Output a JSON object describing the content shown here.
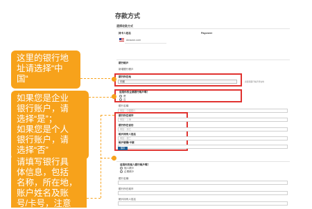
{
  "page_title": "存款方式",
  "section_deposit": "選擇收款方式",
  "account_info": {
    "owner_label": "持卡人姓名",
    "owner_value": "Amazon.com",
    "third_label": "Payoneer",
    "third_value": "Amazon.com"
  },
  "bank_section": {
    "header": "銀行帳戶",
    "subheader": "新增銀行帳戶",
    "country_label": "銀行所在地",
    "country_value": "中國",
    "country_hint": "請選擇銀行帳戶所在地",
    "business_question": "這是你的企業銀行帳戶嗎？",
    "radio_yes": "是",
    "radio_no": "否",
    "bank_name_label": "銀行名稱",
    "bank_name_placeholder": "例如：中國銀行",
    "bank_city_label": "銀行所在城市",
    "bank_city_placeholder": "例如：上海",
    "branch_label": "銀行所在省份",
    "branch_placeholder": "例如：浙江",
    "account_name_label": "帳戶持有人姓名",
    "account_name_placeholder": "例如：張三",
    "account_number_label": "帳戶號碼/卡號",
    "account_number_placeholder": "",
    "save_button": "保存"
  },
  "lower_section": {
    "question": "這是你的個人銀行帳戶嗎？",
    "option_a": "個人帳戶",
    "option_b": "企業帳戶",
    "f1_label": "銀行名稱",
    "f2_label": "銀行所在城市",
    "f3_label": "帳戶持有人姓名"
  },
  "callouts": {
    "c1": [
      "这里的银行地",
      "址请选择“中",
      "国“"
    ],
    "c2": [
      "如果您是企业",
      "银行账户，请",
      "选择“是”；",
      "如果您是个人",
      "银行账户，请",
      "选择“否”"
    ],
    "c3": [
      "请填写银行具",
      "体信息，包括",
      "名称，所在地，",
      "账户姓名及账",
      "号/卡号，注意"
    ]
  },
  "colors": {
    "callout": "#f7a21b",
    "highlight": "#e0312e",
    "button": "#1f5f94"
  }
}
